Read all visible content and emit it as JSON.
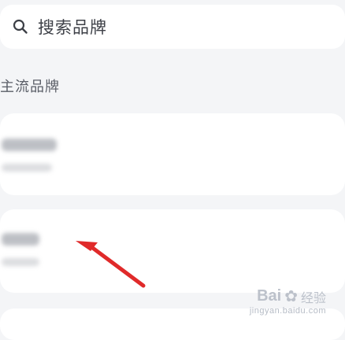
{
  "search": {
    "placeholder": "搜索品牌",
    "icon": "search-icon"
  },
  "sections": {
    "mainstream_title": "主流品牌"
  },
  "brands": [
    {
      "name": "",
      "subtitle": "",
      "blurred": true
    },
    {
      "name": "",
      "subtitle": "",
      "blurred": true
    },
    {
      "name": "",
      "subtitle": "",
      "blurred": true
    }
  ],
  "annotation": {
    "arrow_color": "#e02a2a",
    "arrow_target": "brand-card-2"
  },
  "watermark": {
    "brand": "Bai",
    "suffix": "经验",
    "url": "jingyan.baidu.com"
  }
}
